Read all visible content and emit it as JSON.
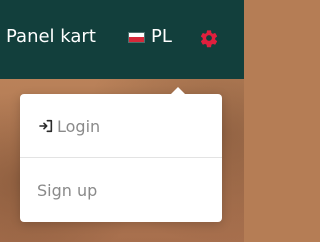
{
  "header": {
    "brand_link": "Panel kart",
    "language": {
      "code": "PL",
      "flag": "poland-flag-icon"
    },
    "settings_icon": "gear-icon",
    "colors": {
      "bar": "#123f3c",
      "text": "#ffffff",
      "accent": "#e01f3d"
    }
  },
  "dropdown": {
    "items": [
      {
        "label": "Login",
        "icon": "login-icon"
      },
      {
        "label": "Sign up"
      }
    ],
    "colors": {
      "background": "#ffffff",
      "text": "#8a8a8a",
      "divider": "#e3e3e3"
    }
  },
  "background": {
    "colors": {
      "base": "#b57d55"
    }
  }
}
